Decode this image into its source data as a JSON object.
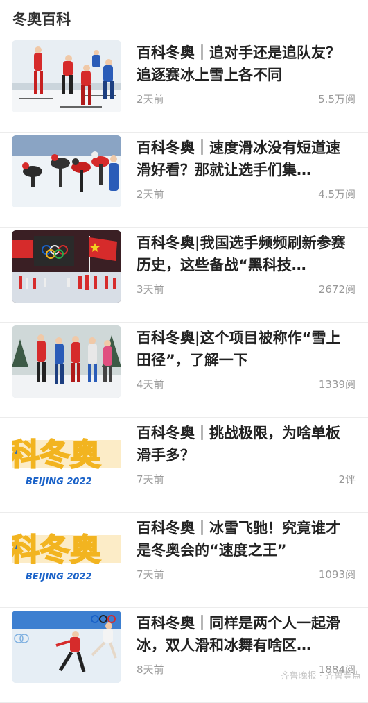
{
  "header": {
    "title": "冬奥百科"
  },
  "items": [
    {
      "title": "百科冬奥｜追对手还是追队友？追逐赛冰上雪上各不同",
      "time": "2天前",
      "views": "5.5万阅",
      "thumb_icon": "cross-country-skiing-photo"
    },
    {
      "title": "百科冬奥｜速度滑冰没有短道速滑好看？那就让选手们集…",
      "time": "2天前",
      "views": "4.5万阅",
      "thumb_icon": "speed-skating-photo"
    },
    {
      "title": "百科冬奥|我国选手频频刷新参赛历史，这些备战“黑科技…",
      "time": "3天前",
      "views": "2672阅",
      "thumb_icon": "olympic-ceremony-photo"
    },
    {
      "title": "百科冬奥|这个项目被称作“雪上田径”，了解一下",
      "time": "4天前",
      "views": "1339阅",
      "thumb_icon": "nordic-skiing-photo"
    },
    {
      "title": "百科冬奥｜挑战极限，为啥单板滑手多？",
      "time": "7天前",
      "views": "2评",
      "thumb_icon": "beijing-2022-logo-thumb"
    },
    {
      "title": "百科冬奥｜冰雪飞驰！究竟谁才是冬奥会的“速度之王”",
      "time": "7天前",
      "views": "1093阅",
      "thumb_icon": "beijing-2022-logo-thumb"
    },
    {
      "title": "百科冬奥｜同样是两个人一起滑冰，双人滑和冰舞有啥区…",
      "time": "8天前",
      "views": "1884阅",
      "thumb_icon": "figure-skating-photo"
    }
  ],
  "thumb_logo": {
    "main": "科冬奥",
    "sub": "BEIJING 2022"
  },
  "watermark": "齐鲁晚报 · 齐鲁壹点",
  "colors": {
    "accent_red": "#d62b2b",
    "logo_blue": "#1a62c8",
    "logo_yellow": "#f2b420",
    "muted_text": "#999999"
  }
}
